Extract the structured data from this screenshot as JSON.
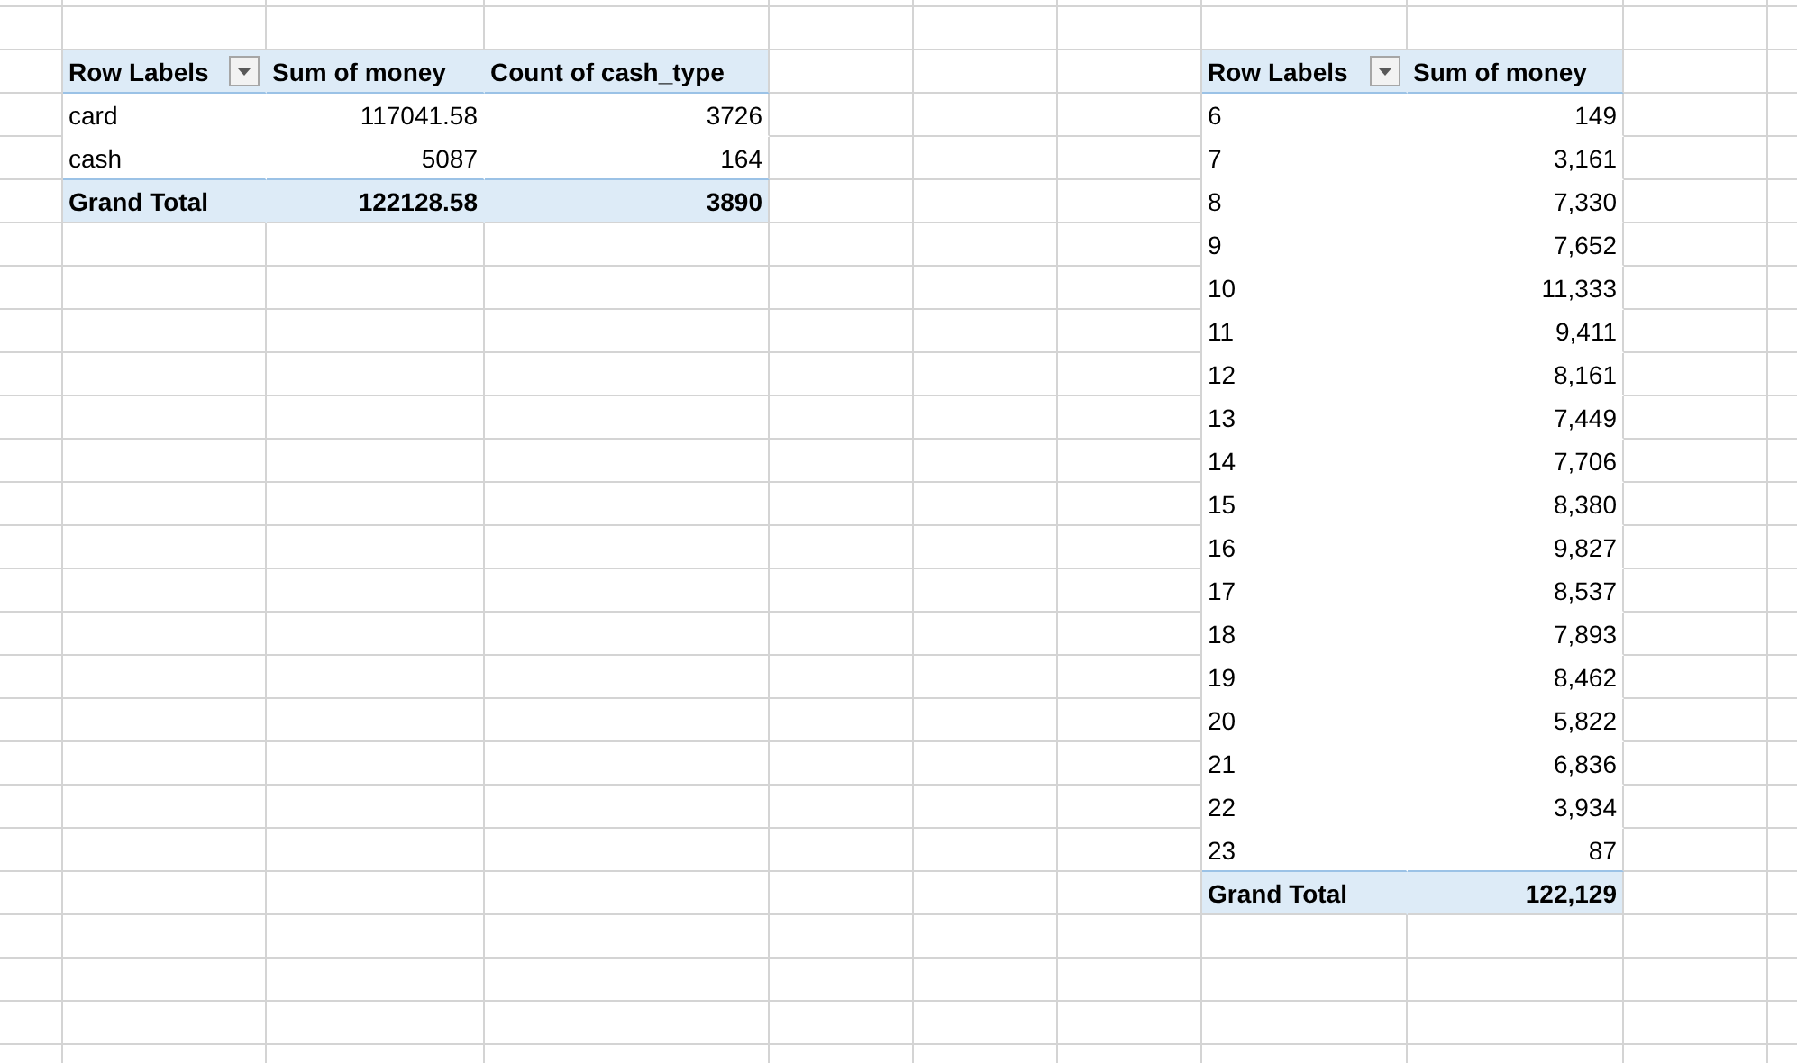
{
  "pivot_tables": [
    {
      "header": {
        "row_label": "Row Labels",
        "columns": [
          "Sum of money",
          "Count of cash_type"
        ]
      },
      "rows": [
        {
          "label": "card",
          "values": [
            "117041.58",
            "3726"
          ]
        },
        {
          "label": "cash",
          "values": [
            "5087",
            "164"
          ]
        }
      ],
      "total": {
        "label": "Grand Total",
        "values": [
          "122128.58",
          "3890"
        ]
      }
    },
    {
      "header": {
        "row_label": "Row Labels",
        "columns": [
          "Sum of money"
        ]
      },
      "rows": [
        {
          "label": "6",
          "values": [
            "149"
          ]
        },
        {
          "label": "7",
          "values": [
            "3,161"
          ]
        },
        {
          "label": "8",
          "values": [
            "7,330"
          ]
        },
        {
          "label": "9",
          "values": [
            "7,652"
          ]
        },
        {
          "label": "10",
          "values": [
            "11,333"
          ]
        },
        {
          "label": "11",
          "values": [
            "9,411"
          ]
        },
        {
          "label": "12",
          "values": [
            "8,161"
          ]
        },
        {
          "label": "13",
          "values": [
            "7,449"
          ]
        },
        {
          "label": "14",
          "values": [
            "7,706"
          ]
        },
        {
          "label": "15",
          "values": [
            "8,380"
          ]
        },
        {
          "label": "16",
          "values": [
            "9,827"
          ]
        },
        {
          "label": "17",
          "values": [
            "8,537"
          ]
        },
        {
          "label": "18",
          "values": [
            "7,893"
          ]
        },
        {
          "label": "19",
          "values": [
            "8,462"
          ]
        },
        {
          "label": "20",
          "values": [
            "5,822"
          ]
        },
        {
          "label": "21",
          "values": [
            "6,836"
          ]
        },
        {
          "label": "22",
          "values": [
            "3,934"
          ]
        },
        {
          "label": "23",
          "values": [
            "87"
          ]
        }
      ],
      "total": {
        "label": "Grand Total",
        "values": [
          "122,129"
        ]
      }
    }
  ]
}
